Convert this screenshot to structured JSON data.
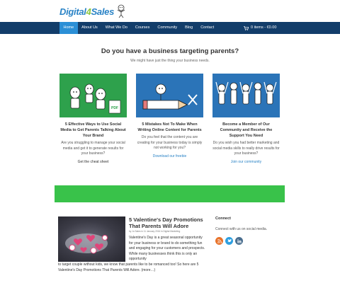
{
  "brand": {
    "logo_part1": "Digital",
    "logo_part2": "4",
    "logo_part3": "Sales"
  },
  "nav": {
    "items": [
      {
        "label": "Home",
        "active": true
      },
      {
        "label": "About Us"
      },
      {
        "label": "What We Do"
      },
      {
        "label": "Courses"
      },
      {
        "label": "Community"
      },
      {
        "label": "Blog"
      },
      {
        "label": "Contact"
      }
    ],
    "cart_label": "0 items - €0.00"
  },
  "hero": {
    "title": "Do you have a business targeting parents?",
    "subtitle": "We might have just the thing your business needs."
  },
  "features": [
    {
      "title": "5 Effective Ways to Use Social Media to Get Parents Talking About Your Brand",
      "text": "Are you struggling to manage your social media and get it to generate results for your business?",
      "link": "Get the cheat sheet",
      "badge": "PDF"
    },
    {
      "title": "5 Mistakes Not To Make When Writing Online Content for Parents",
      "text": "Do you feel that the content you are creating for your business today is simply not working for you?",
      "link": "Download our freebie"
    },
    {
      "title": "Become a Member of Our Community and Receive the Support You Need",
      "text": "Do you wish you had better marketing and social media skills to really drive results for your business?",
      "link": "Join our community"
    }
  ],
  "post": {
    "title": "5 Valentine's Day Promotions That Parents Will Adore",
    "meta": "by Jo Sales in 11 January 2016 in Digital Marketing",
    "body_right": "Valentine's Day is a great seasonal opportunity for your business or brand to do something fun and engaging for your customers and prospects. While many businesses think this is only an opportunity",
    "body_full": "to target couple without kids, we know that parents like to be romanced too! So here are 5 Valentine's Day Promotions That Parents Will Adore. (more…)"
  },
  "sidebar": {
    "title": "Connect",
    "text": "Connect with us on social media.",
    "social": [
      {
        "icon": "rss-icon",
        "glyph": "●",
        "color": "#e8722a"
      },
      {
        "icon": "twitter-icon",
        "glyph": "t",
        "color": "#2d9fe0"
      },
      {
        "icon": "linkedin-icon",
        "glyph": "in",
        "color": "#4a6e8f"
      }
    ]
  },
  "colors": {
    "navbar": "#123d6a",
    "nav_active": "#2b8fd6",
    "feature_green": "#2ea14c",
    "feature_blue": "#2b74b8",
    "banner_green": "#39c24a",
    "link_blue": "#2a83c6"
  }
}
